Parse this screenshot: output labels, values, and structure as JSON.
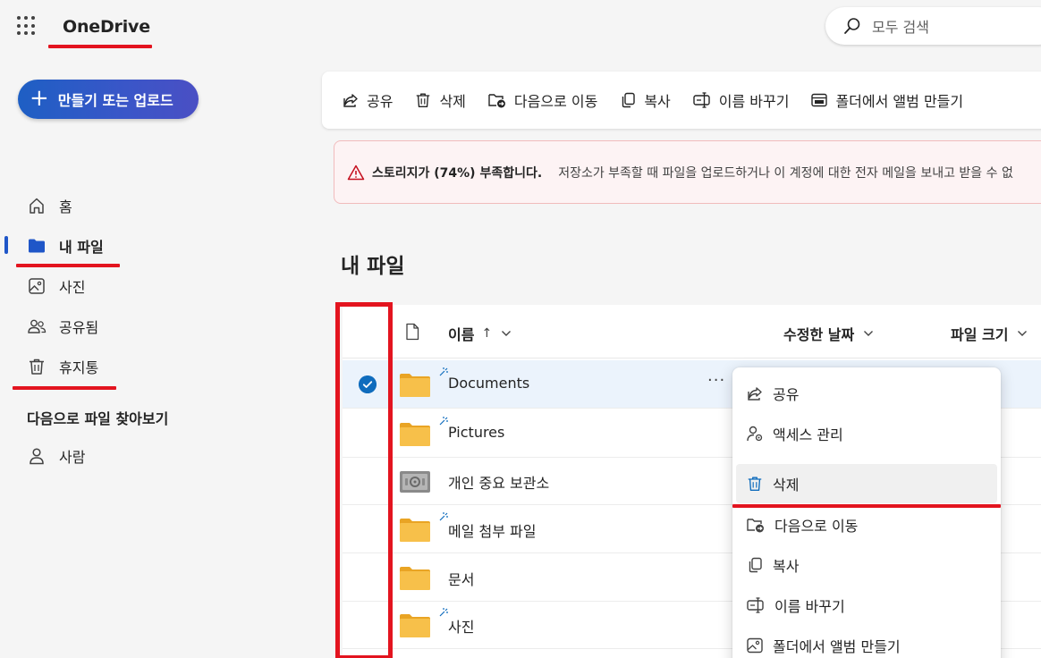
{
  "app": {
    "name": "OneDrive"
  },
  "search": {
    "placeholder": "모두 검색"
  },
  "create_button": {
    "label": "만들기 또는 업로드"
  },
  "sidebar": {
    "items": [
      {
        "label": "홈",
        "icon": "home-icon"
      },
      {
        "label": "내 파일",
        "icon": "folder-icon",
        "active": true
      },
      {
        "label": "사진",
        "icon": "photo-icon"
      },
      {
        "label": "공유됨",
        "icon": "people-icon"
      },
      {
        "label": "휴지통",
        "icon": "trash-icon"
      }
    ],
    "section_title": "다음으로 파일 찾아보기",
    "section_items": [
      {
        "label": "사람",
        "icon": "person-icon"
      }
    ]
  },
  "toolbar": {
    "share": "공유",
    "delete": "삭제",
    "move_to": "다음으로 이동",
    "copy": "복사",
    "rename": "이름 바꾸기",
    "create_album": "폴더에서 앨범 만들기"
  },
  "banner": {
    "title": "스토리지가 (74%) 부족합니다.",
    "text": "저장소가 부족할 때 파일을 업로드하거나 이 계정에 대한 전자 메일을 보내고 받을 수 없",
    "storage_percent": 74,
    "color": "#c50f1f"
  },
  "page_title": "내 파일",
  "columns": {
    "name": "이름",
    "name_sort": "↑",
    "modified": "수정한 날짜",
    "size": "파일 크기"
  },
  "files": [
    {
      "name": "Documents",
      "type": "folder",
      "selected": true,
      "new": true
    },
    {
      "name": "Pictures",
      "type": "folder",
      "new": true
    },
    {
      "name": "개인 중요 보관소",
      "type": "vault"
    },
    {
      "name": "메일 첨부 파일",
      "type": "folder",
      "new": true
    },
    {
      "name": "문서",
      "type": "folder"
    },
    {
      "name": "사진",
      "type": "folder",
      "new": true
    }
  ],
  "context_menu": {
    "items": [
      {
        "label": "공유",
        "icon": "share-icon"
      },
      {
        "label": "액세스 관리",
        "icon": "manage-access-icon"
      },
      {
        "label": "삭제",
        "icon": "trash-icon",
        "highlighted": true
      },
      {
        "label": "다음으로 이동",
        "icon": "move-icon"
      },
      {
        "label": "복사",
        "icon": "copy-icon"
      },
      {
        "label": "이름 바꾸기",
        "icon": "rename-icon"
      },
      {
        "label": "폴더에서 앨범 만들기",
        "icon": "album-icon"
      }
    ]
  },
  "colors": {
    "accent": "#0f6cbd",
    "annotation": "#e3141f",
    "folder": "#f5b93b"
  }
}
